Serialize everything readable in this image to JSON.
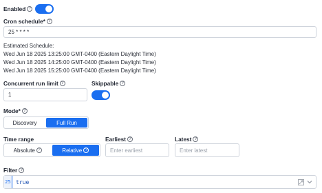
{
  "enabled": {
    "label": "Enabled",
    "on": true
  },
  "cron": {
    "label": "Cron schedule*",
    "value": "25 * * * *"
  },
  "estimated": {
    "label": "Estimated Schedule:",
    "items": [
      "Wed Jun 18 2025 13:25:00 GMT-0400 (Eastern Daylight Time)",
      "Wed Jun 18 2025 14:25:00 GMT-0400 (Eastern Daylight Time)",
      "Wed Jun 18 2025 15:25:00 GMT-0400 (Eastern Daylight Time)"
    ]
  },
  "concurrent": {
    "label": "Concurrent run limit",
    "value": "1"
  },
  "skippable": {
    "label": "Skippable",
    "on": true
  },
  "mode": {
    "label": "Mode*",
    "options": [
      "Discovery",
      "Full Run"
    ],
    "selected": "Full Run"
  },
  "time_range": {
    "label": "Time range",
    "options": [
      "Absolute",
      "Relative"
    ],
    "selected": "Relative"
  },
  "earliest": {
    "label": "Earliest",
    "placeholder": "Enter earliest"
  },
  "latest": {
    "label": "Latest",
    "placeholder": "Enter latest"
  },
  "filter": {
    "label": "Filter",
    "line_number": "25",
    "code": "true"
  },
  "colors": {
    "accent": "#1a6ef0",
    "border": "#cfd4dc",
    "placeholder": "#9aa1ab"
  }
}
